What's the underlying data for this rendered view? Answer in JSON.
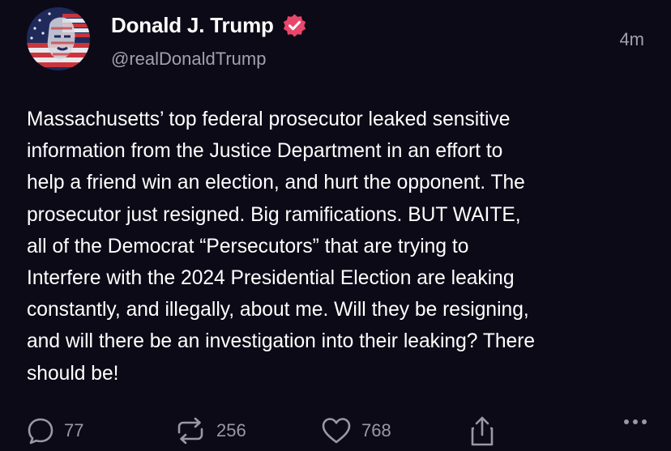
{
  "post": {
    "author": {
      "display_name": "Donald J. Trump",
      "handle": "@realDonaldTrump",
      "verified_icon": "verified-badge-icon",
      "avatar_icon": "avatar-flag-portrait"
    },
    "timestamp": "4m",
    "lines": [
      "Massachusetts’ top federal prosecutor leaked sensitive",
      "information from the Justice Department in an effort to",
      "help a friend win an election, and hurt the opponent. The",
      "prosecutor just resigned. Big ramifications. BUT WAITE,",
      "all of the Democrat “Persecutors” that are trying to",
      "Interfere with the 2024 Presidential Election are leaking",
      "constantly, and illegally, about me. Will they be resigning,",
      "and will there be an investigation into their leaking? There",
      "should be!"
    ]
  },
  "actions": {
    "reply_count": "77",
    "repost_count": "256",
    "like_count": "768",
    "icons": [
      "reply-icon",
      "repost-icon",
      "like-icon",
      "share-icon",
      "more-icon"
    ]
  },
  "colors": {
    "background": "#0d0a17",
    "text": "#ffffff",
    "secondary_text": "#a3a0ad",
    "verified_badge": "#e8476b"
  }
}
